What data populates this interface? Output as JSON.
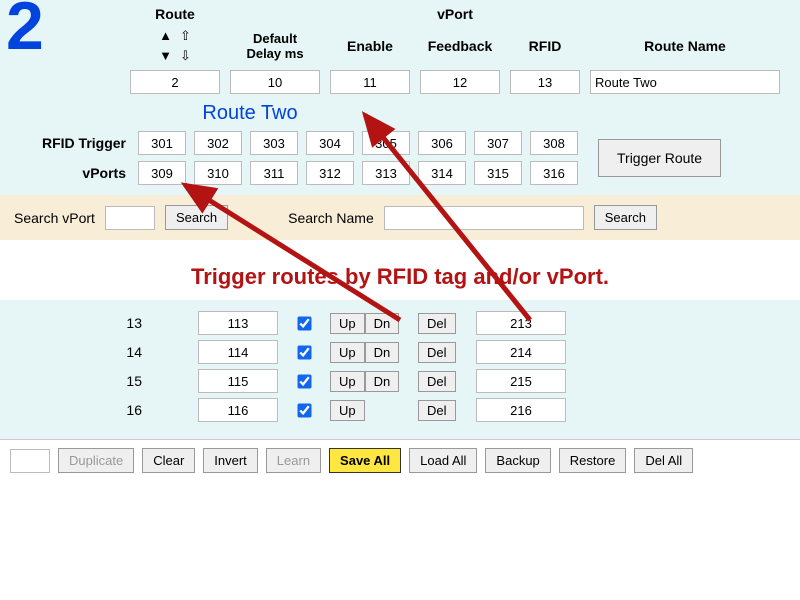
{
  "panel_number": "2",
  "headers": {
    "route": "Route",
    "vport": "vPort",
    "default_delay": "Default\nDelay ms",
    "enable": "Enable",
    "feedback": "Feedback",
    "rfid": "RFID",
    "route_name": "Route Name"
  },
  "route_values": {
    "route": "2",
    "delay": "10",
    "enable": "11",
    "feedback": "12",
    "rfid": "13",
    "name": "Route Two"
  },
  "route_name_caption": "Route Two",
  "rfid_trigger_label": "RFID Trigger",
  "vports_label": "vPorts",
  "rfid_row": [
    "301",
    "302",
    "303",
    "304",
    "305",
    "306",
    "307",
    "308"
  ],
  "vports_row": [
    "309",
    "310",
    "311",
    "312",
    "313",
    "314",
    "315",
    "316"
  ],
  "trigger_route_btn": "Trigger Route",
  "search": {
    "vport_label": "Search vPort",
    "name_label": "Search Name",
    "button": "Search",
    "vport_value": "",
    "name_value": ""
  },
  "caption": "Trigger routes by RFID tag and/or vPort.",
  "rows": [
    {
      "n": "13",
      "a": "113",
      "checked": true,
      "up": true,
      "dn": true,
      "b": "213"
    },
    {
      "n": "14",
      "a": "114",
      "checked": true,
      "up": true,
      "dn": true,
      "b": "214"
    },
    {
      "n": "15",
      "a": "115",
      "checked": true,
      "up": true,
      "dn": true,
      "b": "215"
    },
    {
      "n": "16",
      "a": "116",
      "checked": true,
      "up": true,
      "dn": false,
      "b": "216"
    }
  ],
  "row_buttons": {
    "up": "Up",
    "dn": "Dn",
    "del": "Del"
  },
  "footer": {
    "duplicate": "Duplicate",
    "clear": "Clear",
    "invert": "Invert",
    "learn": "Learn",
    "save_all": "Save All",
    "load_all": "Load All",
    "backup": "Backup",
    "restore": "Restore",
    "del_all": "Del All"
  }
}
